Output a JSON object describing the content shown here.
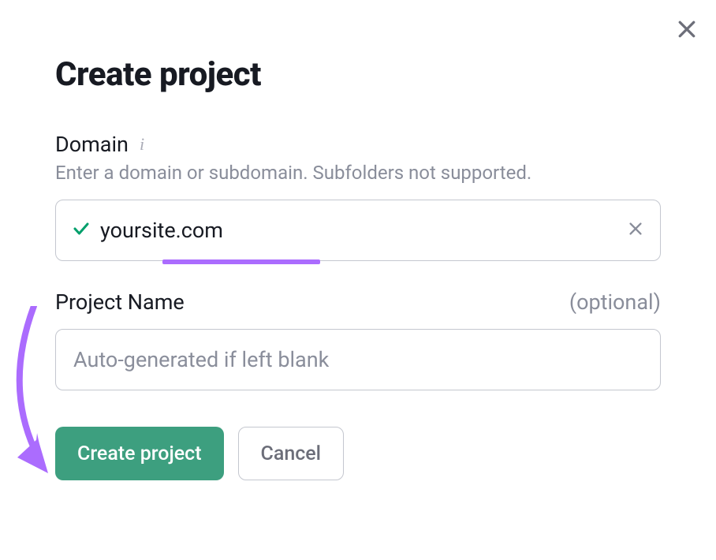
{
  "dialog": {
    "title": "Create project",
    "domain": {
      "label": "Domain",
      "help": "Enter a domain or subdomain. Subfolders not supported.",
      "value": "yoursite.com"
    },
    "project_name": {
      "label": "Project Name",
      "optional": "(optional)",
      "placeholder": "Auto-generated if left blank",
      "value": ""
    },
    "actions": {
      "create": "Create project",
      "cancel": "Cancel"
    }
  },
  "colors": {
    "primary_button": "#3d9f7f",
    "annotation": "#ab6cfe",
    "valid": "#009f6b"
  }
}
